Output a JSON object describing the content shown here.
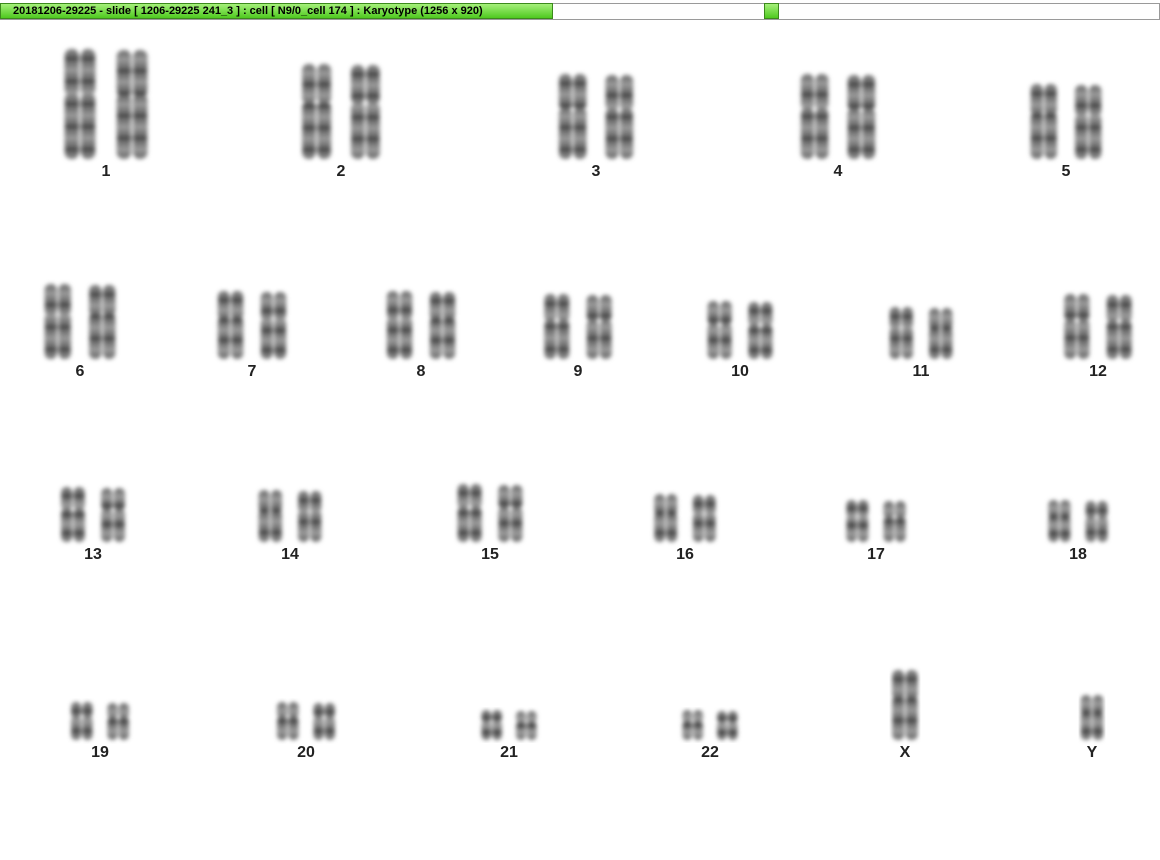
{
  "window": {
    "title": "20181206-29225 - slide [ 1206-29225 241_3 ] : cell [ N9/0_cell 174 ] : Karyotype  (1256 x 920)"
  },
  "karyotype": {
    "chromosomes": [
      {
        "label": "1"
      },
      {
        "label": "2"
      },
      {
        "label": "3"
      },
      {
        "label": "4"
      },
      {
        "label": "5"
      },
      {
        "label": "6"
      },
      {
        "label": "7"
      },
      {
        "label": "8"
      },
      {
        "label": "9"
      },
      {
        "label": "10"
      },
      {
        "label": "11"
      },
      {
        "label": "12"
      },
      {
        "label": "13"
      },
      {
        "label": "14"
      },
      {
        "label": "15"
      },
      {
        "label": "16"
      },
      {
        "label": "17"
      },
      {
        "label": "18"
      },
      {
        "label": "19"
      },
      {
        "label": "20"
      },
      {
        "label": "21"
      },
      {
        "label": "22"
      },
      {
        "label": "X"
      },
      {
        "label": "Y"
      }
    ]
  }
}
